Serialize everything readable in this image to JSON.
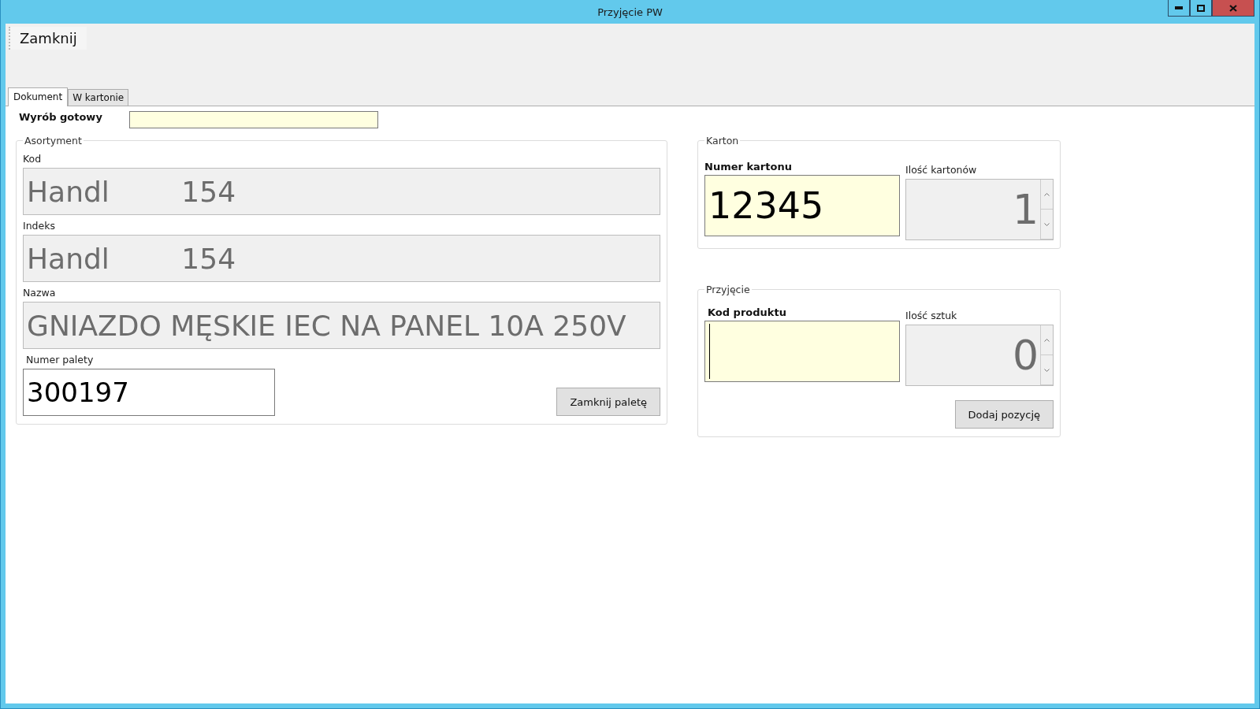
{
  "window": {
    "title": "Przyjęcie PW"
  },
  "toolbar": {
    "buttons": [
      "Zamknij"
    ]
  },
  "tabs": [
    {
      "label": "Dokument",
      "selected": true
    },
    {
      "label": "W kartonie",
      "selected": false
    }
  ],
  "finished_product": {
    "label": "Wyrób gotowy"
  },
  "assortment": {
    "title": "Asortyment",
    "fields": [
      {
        "label": "Kod",
        "value": "Handl        154",
        "disabled": true
      },
      {
        "label": "Indeks",
        "value": "Handl        154",
        "disabled": true
      },
      {
        "label": "Nazwa",
        "value": "GNIAZDO MĘSKIE IEC NA PANEL 10A 250V",
        "disabled": true
      }
    ],
    "pallet": {
      "label": "Numer palety",
      "value": "300197"
    },
    "button": "Zamknij paletę"
  },
  "carton": {
    "title": "Karton",
    "number": {
      "label": "Numer kartonu",
      "value": "12345"
    },
    "count": {
      "label": "Ilość kartonów",
      "value": "1"
    }
  },
  "receipt": {
    "title": "Przyjęcie",
    "product_code": {
      "label": "Kod produktu"
    },
    "quantity": {
      "label": "Ilość sztuk",
      "value": "0"
    },
    "button": "Dodaj pozycję"
  }
}
